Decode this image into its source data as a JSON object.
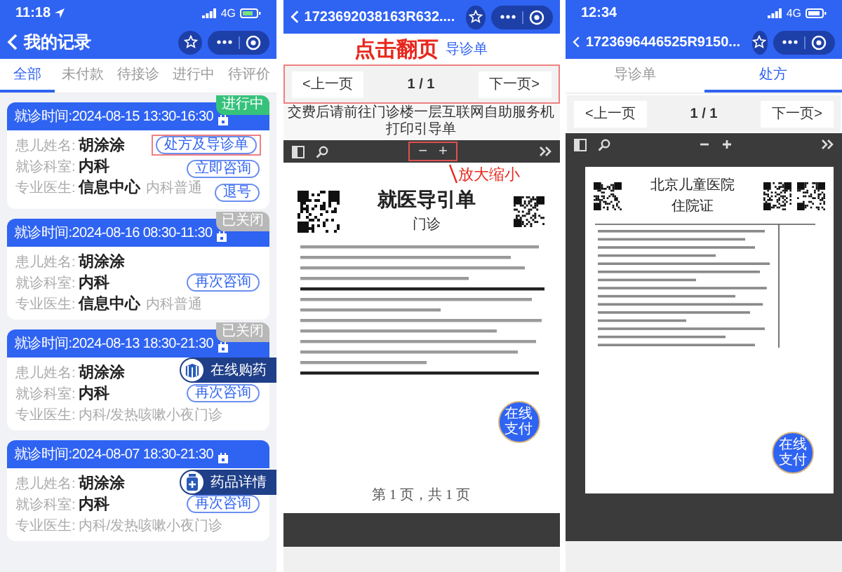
{
  "records_screen": {
    "status_bar": {
      "time": "11:18",
      "network": "4G"
    },
    "title": "我的记录",
    "tabs": [
      {
        "label": "全部",
        "selected": true
      },
      {
        "label": "未付款",
        "selected": false
      },
      {
        "label": "待接诊",
        "selected": false
      },
      {
        "label": "进行中",
        "selected": false
      },
      {
        "label": "待评价",
        "selected": false
      }
    ],
    "records": [
      {
        "visit_time": "就诊时间:2024-08-15 13:30-16:30",
        "status": "进行中",
        "closed": false,
        "fields": [
          {
            "label": "患儿姓名:",
            "value": "胡涂涂",
            "muted": false
          },
          {
            "label": "就诊科室:",
            "value": "内科",
            "muted": false
          },
          {
            "label": "专业医生:",
            "value": "信息中心",
            "note": "内科普通",
            "muted": false
          }
        ],
        "buttons": [
          {
            "label": "处方及导诊单",
            "highlighted": true
          },
          {
            "label": "立即咨询",
            "highlighted": false
          },
          {
            "label": "退号",
            "highlighted": false
          }
        ]
      },
      {
        "visit_time": "就诊时间:2024-08-16 08:30-11:30",
        "status": "已关闭",
        "closed": true,
        "fields": [
          {
            "label": "患儿姓名:",
            "value": "胡涂涂",
            "muted": false
          },
          {
            "label": "就诊科室:",
            "value": "内科",
            "muted": false
          },
          {
            "label": "专业医生:",
            "value": "信息中心",
            "note": "内科普通",
            "muted": false
          }
        ],
        "buttons": [
          {
            "label": "再次咨询",
            "highlighted": false
          }
        ]
      },
      {
        "visit_time": "就诊时间:2024-08-13 18:30-21:30",
        "status": "已关闭",
        "closed": true,
        "fields": [
          {
            "label": "患儿姓名:",
            "value": "胡涂涂",
            "muted": false
          },
          {
            "label": "就诊科室:",
            "value": "内科",
            "muted": false
          },
          {
            "label": "专业医生:",
            "value": "内科/发热咳嗽小夜门诊",
            "muted": true
          }
        ],
        "buttons": [
          {
            "label": "再次咨询",
            "highlighted": false
          }
        ]
      },
      {
        "visit_time": "就诊时间:2024-08-07 18:30-21:30",
        "fields": [
          {
            "label": "患儿姓名:",
            "value": "胡涂涂",
            "muted": false
          },
          {
            "label": "就诊科室:",
            "value": "内科",
            "muted": false
          },
          {
            "label": "专业医生:",
            "value": "内科/发热咳嗽小夜门诊",
            "muted": true
          }
        ],
        "buttons": [
          {
            "label": "再次咨询",
            "highlighted": false
          }
        ]
      }
    ],
    "floating_buttons": [
      {
        "label": "在线购药",
        "kind": "box"
      },
      {
        "label": "药品详情",
        "kind": "bottle"
      }
    ]
  },
  "guide_screen": {
    "title": "1723692038163R632....",
    "annotation": "点击翻页",
    "tab_label": "导诊单",
    "pager": {
      "prev": "<上一页",
      "page": "1 / 1",
      "next": "下一页>",
      "highlighted": true
    },
    "notice": "交费后请前往门诊楼一层互联网自助服务机打印引导单",
    "viewer": {
      "zoom_out": "−",
      "zoom_in": "+",
      "zoom_highlighted": true,
      "zoom_annotation": "放大缩小"
    },
    "document": {
      "title": "就医导引单",
      "subtitle": "门诊",
      "footer": "第 1 页，共 1 页"
    },
    "pay_button": "在线支付"
  },
  "prescription_screen": {
    "status_bar": {
      "time": "12:34",
      "network": "4G"
    },
    "title": "1723696446525R9150...",
    "tabs": [
      {
        "label": "导诊单",
        "selected": false
      },
      {
        "label": "处方",
        "selected": true
      }
    ],
    "pager": {
      "prev": "<上一页",
      "page": "1 / 1",
      "next": "下一页>",
      "highlighted": false
    },
    "document": {
      "hospital": "北京儿童医院",
      "title": "住院证"
    },
    "pay_button": "在线支付"
  }
}
